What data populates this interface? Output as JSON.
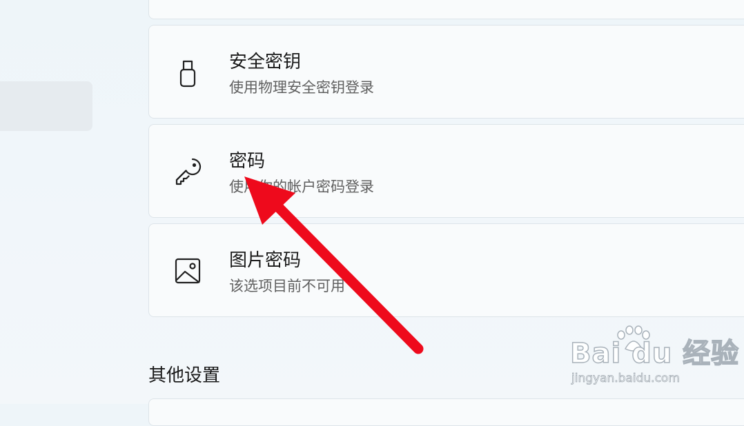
{
  "options": [
    {
      "title": "安全密钥",
      "subtitle": "使用物理安全密钥登录",
      "icon": "usb-key-icon"
    },
    {
      "title": "密码",
      "subtitle": "使用你的帐户密码登录",
      "icon": "key-icon"
    },
    {
      "title": "图片密码",
      "subtitle": "该选项目前不可用",
      "icon": "picture-icon"
    }
  ],
  "section": {
    "title": "其他设置"
  },
  "annotation": {
    "arrow_color": "#ee0a1c"
  },
  "watermark": {
    "brand": "Bai du 经验",
    "url": "jingyan.baidu.com"
  }
}
